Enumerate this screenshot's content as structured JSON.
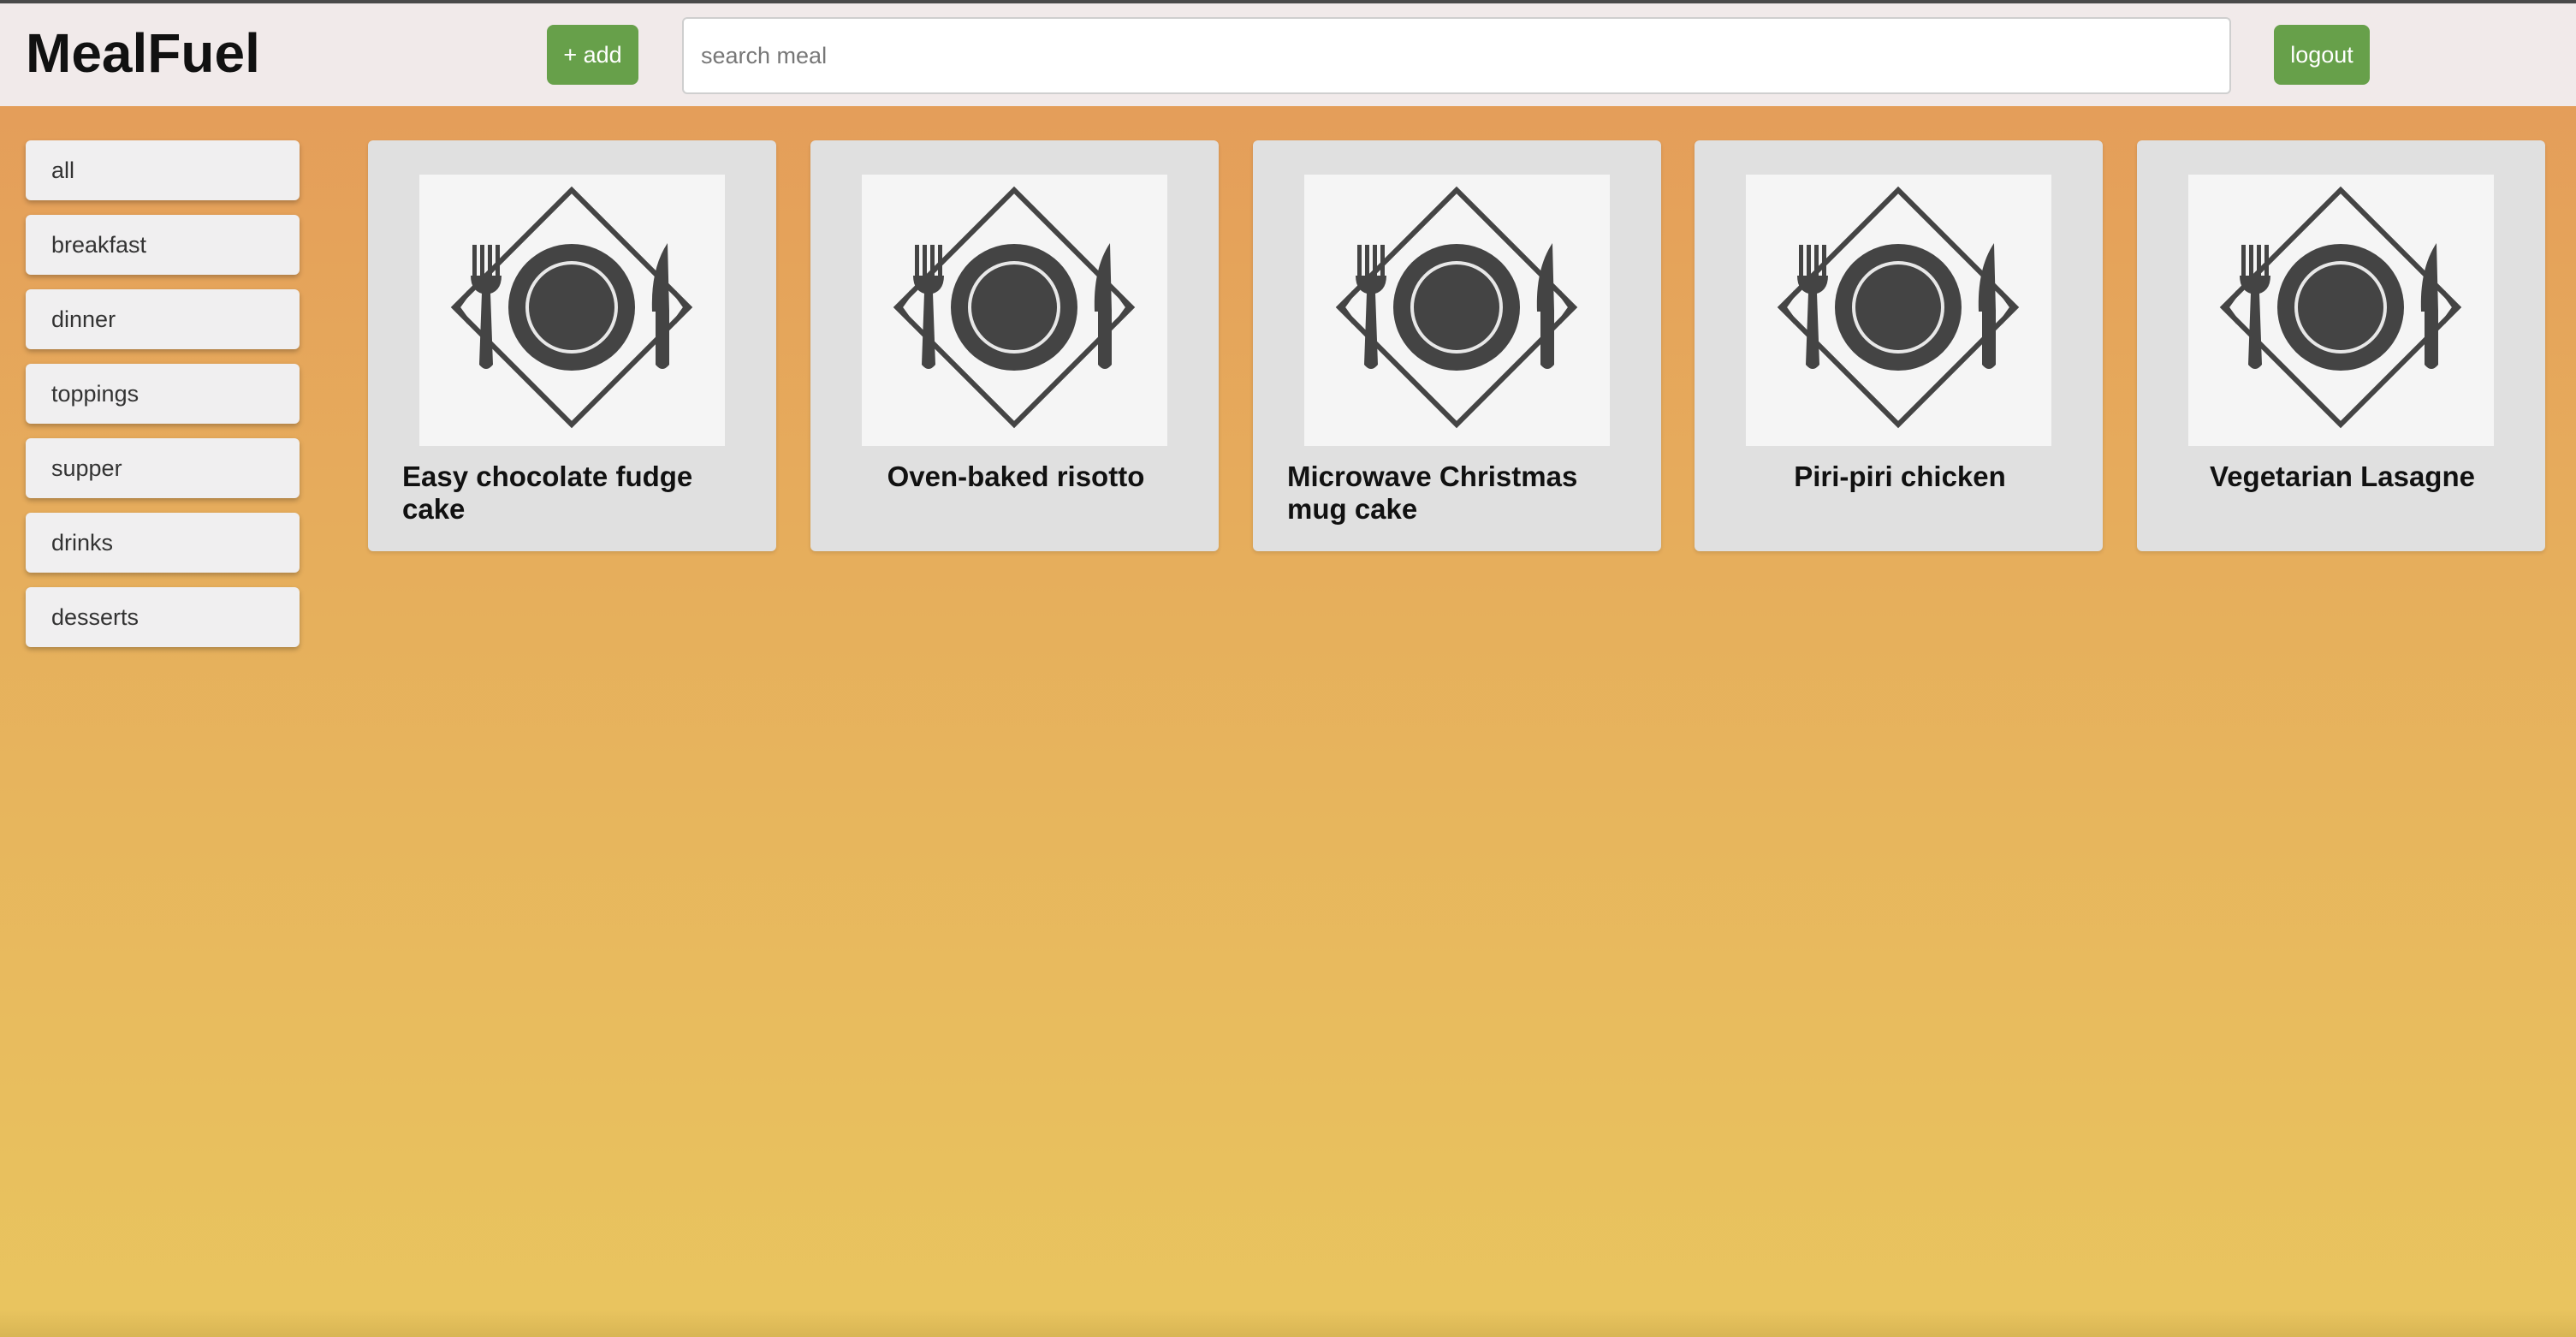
{
  "app": {
    "title": "MealFuel"
  },
  "header": {
    "add_label": "+ add",
    "search_placeholder": "search meal",
    "search_value": "",
    "logout_label": "logout"
  },
  "sidebar": {
    "categories": [
      {
        "label": "all"
      },
      {
        "label": "breakfast"
      },
      {
        "label": "dinner"
      },
      {
        "label": "toppings"
      },
      {
        "label": "supper"
      },
      {
        "label": "drinks"
      },
      {
        "label": "desserts"
      }
    ]
  },
  "meals": [
    {
      "title": "Easy chocolate fudge cake",
      "image_icon": "plate-cutlery-icon"
    },
    {
      "title": "Oven-baked risotto",
      "image_icon": "plate-cutlery-icon"
    },
    {
      "title": "Microwave Christmas mug cake",
      "image_icon": "plate-cutlery-icon"
    },
    {
      "title": "Piri-piri chicken",
      "image_icon": "plate-cutlery-icon"
    },
    {
      "title": "Vegetarian Lasagne",
      "image_icon": "plate-cutlery-icon"
    }
  ],
  "colors": {
    "accent_green": "#67a04a",
    "header_bg": "#f1eaea",
    "background_top": "#e49a59",
    "background_bottom": "#e9c55f"
  }
}
